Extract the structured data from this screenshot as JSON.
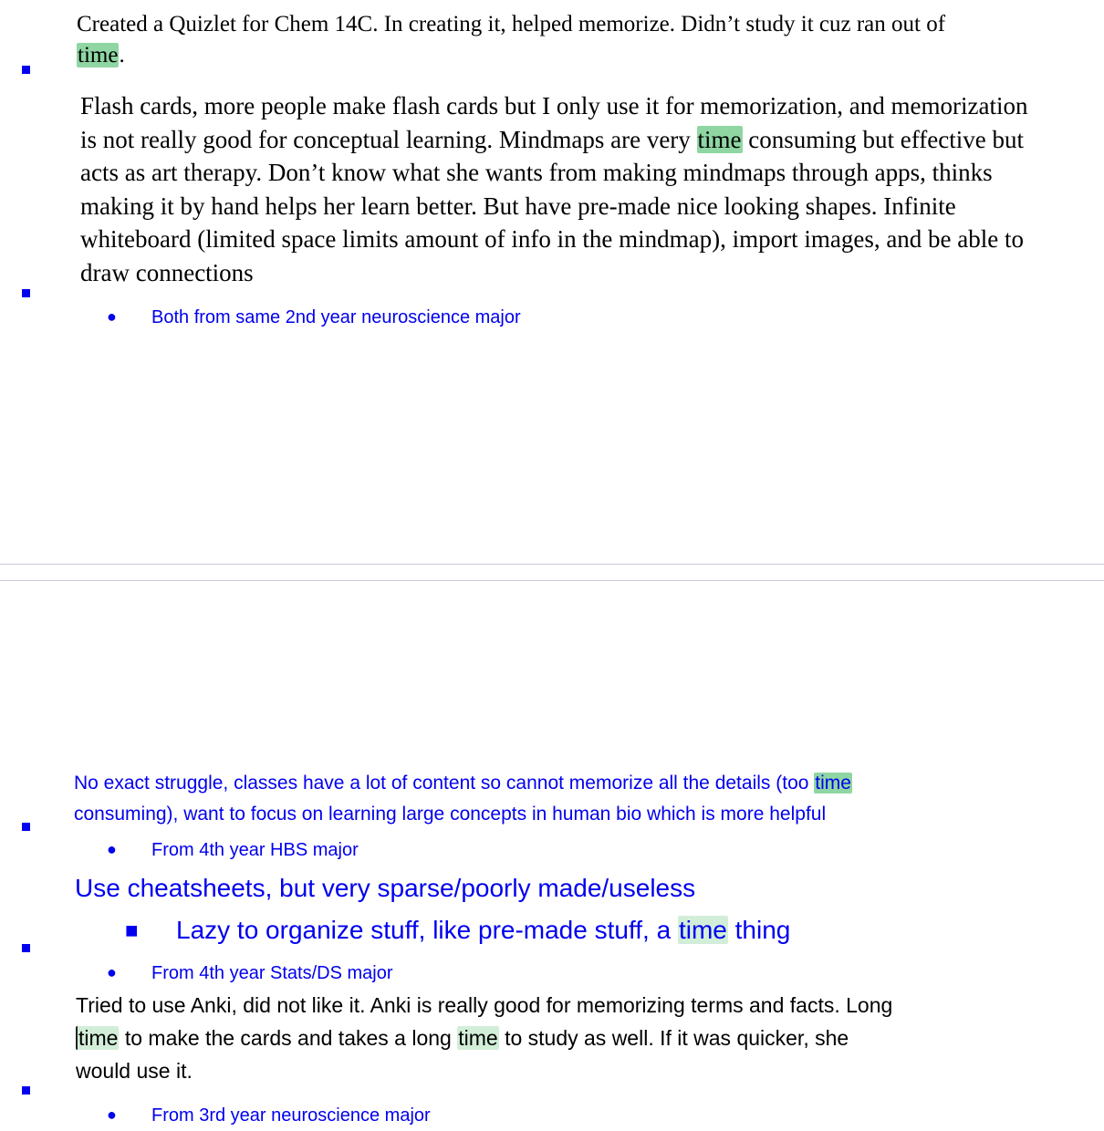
{
  "note1": {
    "line1": "Created a Quizlet for Chem 14C. In creating it, helped memorize. Didn’t study it cuz ran out of",
    "hl": "time",
    "after": "."
  },
  "note2": {
    "line1": "Flash cards, more people make flash cards but I only use it for memorization, and memorization",
    "line2_before": "is not really good for conceptual learning. Mindmaps are very ",
    "line2_hl": "time",
    "line2_after": " consuming but effective but",
    "line3": "acts as art therapy. Don’t know what she wants from making mindmaps through apps, thinks",
    "line4": "making it by hand helps her learn better. But have pre-made nice looking shapes. Infinite",
    "line5": "whiteboard (limited space limits amount of info in the mindmap), import images,  and be able to",
    "line6": "draw connections",
    "source": "Both from same 2nd year neuroscience major"
  },
  "note3": {
    "line1_before": "No exact struggle, classes have a lot of content so cannot memorize all the details (too ",
    "line1_hl": "time",
    "line2": "consuming), want to focus on learning large concepts in human bio which is more helpful",
    "source": "From 4th year HBS major"
  },
  "note4": {
    "heading": "Use cheatsheets, but very sparse/poorly made/useless",
    "sub_before": "Lazy to organize stuff, like pre-made stuff, a ",
    "sub_hl": "time",
    "sub_after": " thing",
    "sub_bullet": "■",
    "source": "From 4th year Stats/DS major"
  },
  "note5": {
    "line1": "Tried to use Anki, did not like it. Anki is really good for memorizing terms and facts. Long",
    "line2_hl1": "time",
    "line2_mid": " to make the cards and takes a long ",
    "line2_hl2": "time",
    "line2_after": " to study as well. If it was quicker, she",
    "line3": "would use it.",
    "source": "From 3rd year neuroscience major"
  },
  "bullet_symbol": "●",
  "colors": {
    "link_blue": "#0000ee",
    "highlight_strong": "#8fd6a3",
    "highlight_light": "#d2eed9"
  }
}
